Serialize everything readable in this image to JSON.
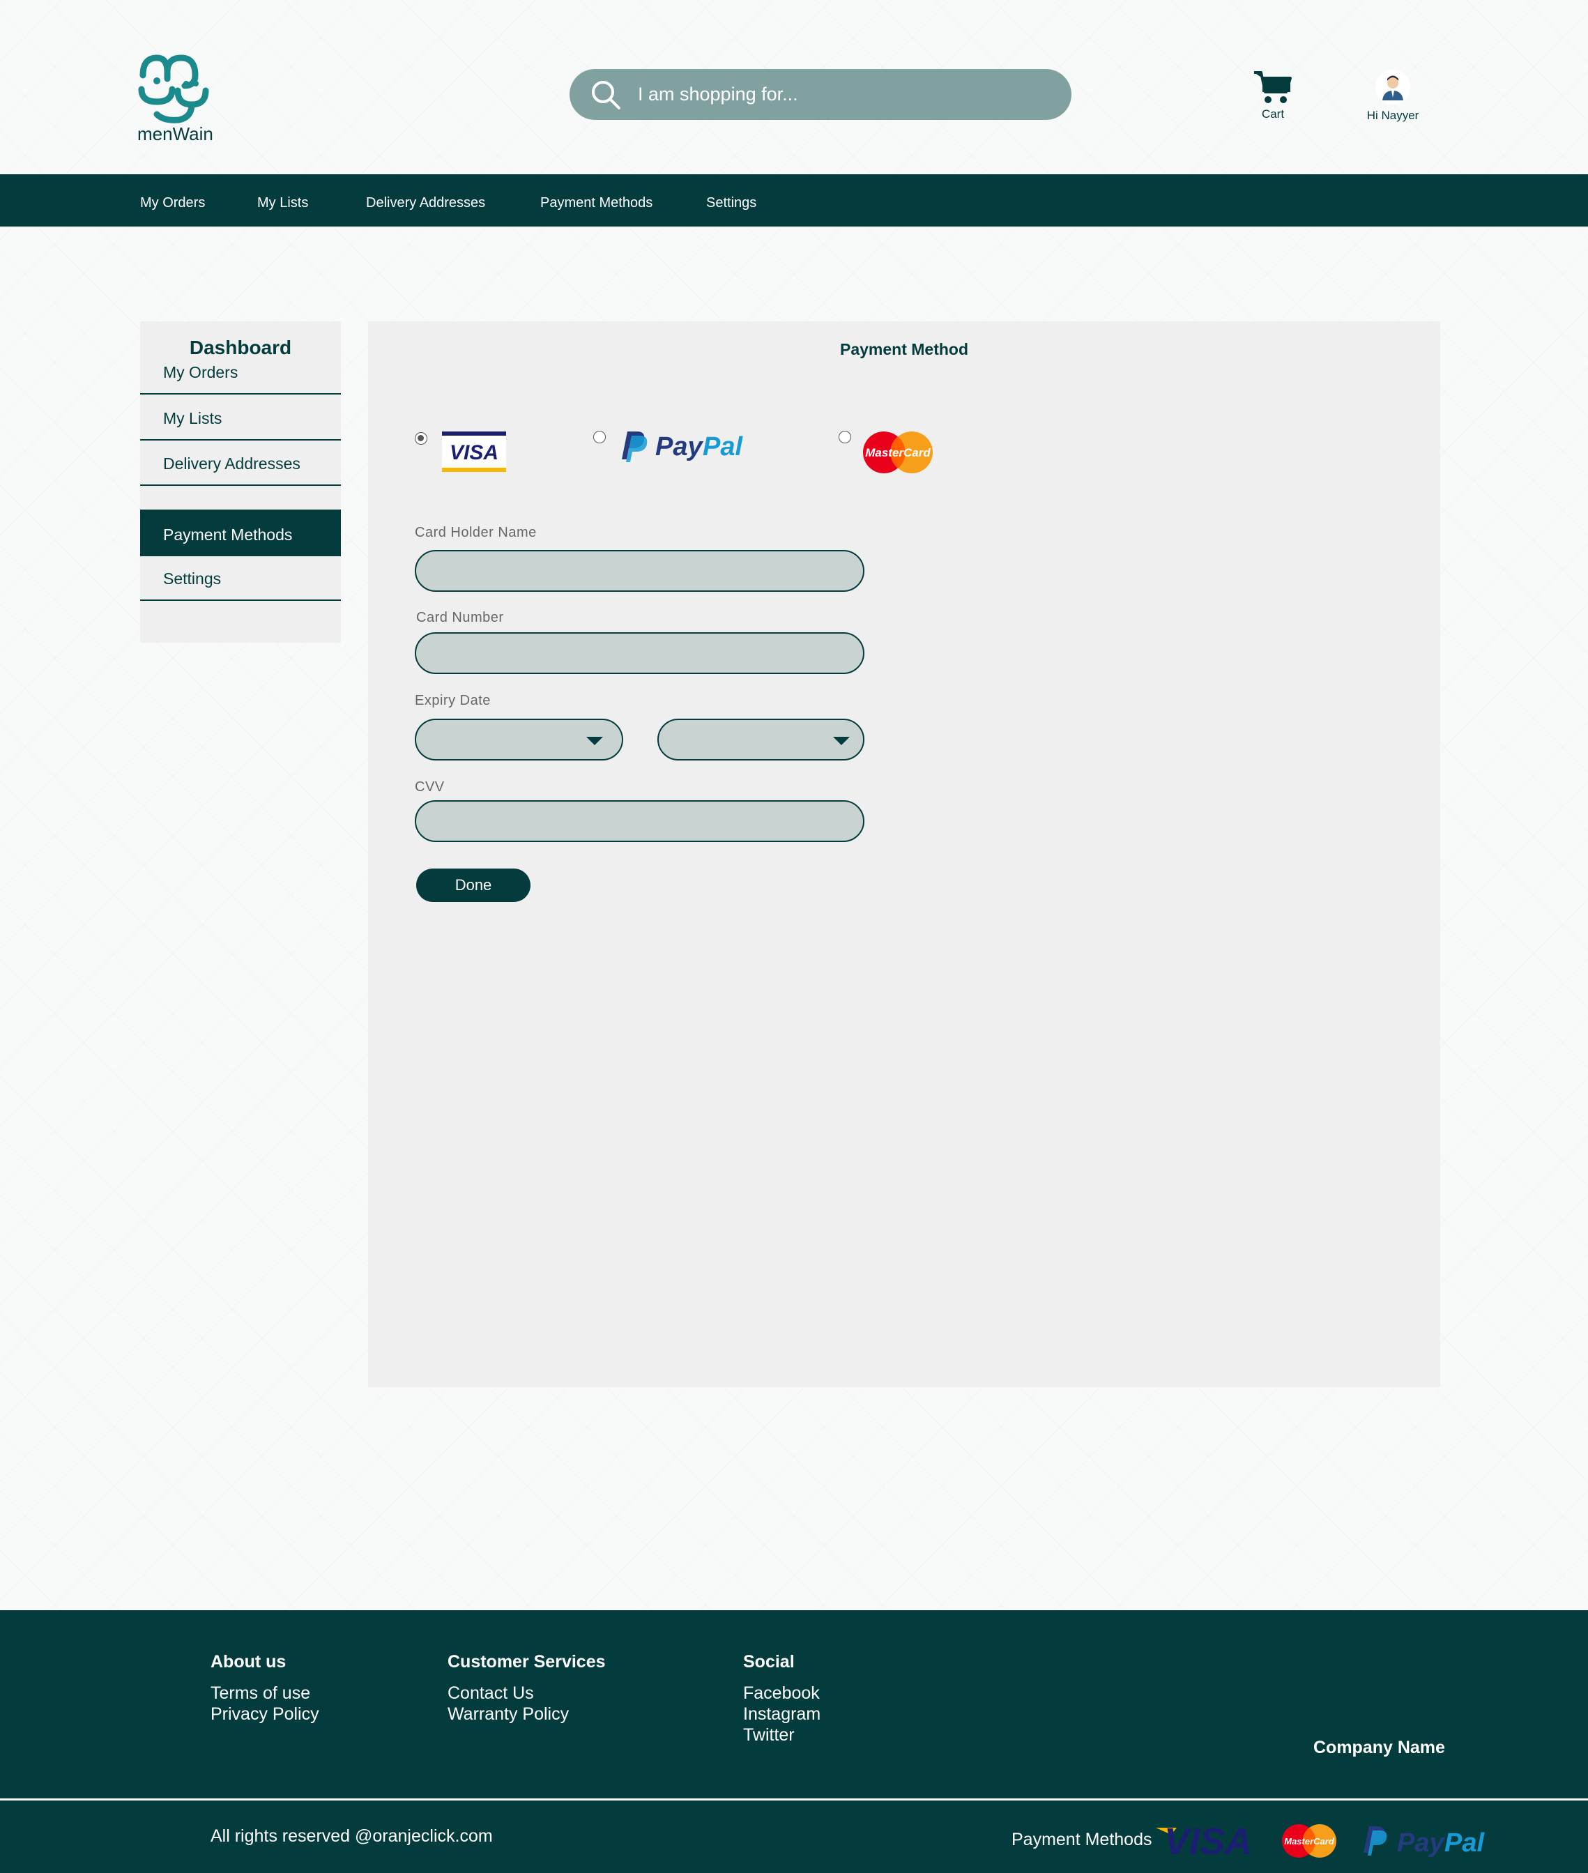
{
  "header": {
    "logo_text": "menWain",
    "search": {
      "placeholder": "I am shopping for..."
    },
    "cart_label": "Cart",
    "user_label": "Hi Nayyer"
  },
  "topnav": {
    "items": [
      {
        "label": "My Orders"
      },
      {
        "label": "My Lists"
      },
      {
        "label": "Delivery Addresses"
      },
      {
        "label": "Payment Methods"
      },
      {
        "label": "Settings"
      }
    ]
  },
  "sidebar": {
    "title": "Dashboard",
    "items": [
      {
        "label": "My Orders"
      },
      {
        "label": "My Lists"
      },
      {
        "label": "Delivery Addresses"
      },
      {
        "label": "Payment Methods",
        "active": true
      },
      {
        "label": "Settings"
      }
    ]
  },
  "payment_form": {
    "title": "Payment Method",
    "options": [
      {
        "name": "VISA",
        "selected": true
      },
      {
        "name": "PayPal",
        "selected": false
      },
      {
        "name": "MasterCard",
        "selected": false
      }
    ],
    "card_holder_label": "Card Holder Name",
    "card_number_label": "Card Number",
    "expiry_label": "Expiry Date",
    "cvv_label": "CVV",
    "done_label": "Done"
  },
  "footer": {
    "about": {
      "heading": "About us",
      "links": [
        "Terms of use",
        "Privacy Policy"
      ]
    },
    "services": {
      "heading": "Customer Services",
      "links": [
        "Contact Us",
        "Warranty Policy"
      ]
    },
    "social": {
      "heading": "Social",
      "links": [
        "Facebook",
        "Instagram",
        "Twitter"
      ]
    },
    "company": "Company Name",
    "copyright": "All rights reserved @oranjeclick.com",
    "payment_methods_label": "Payment Methods",
    "payment_logos": [
      "VISA",
      "MasterCard",
      "PayPal"
    ]
  },
  "colors": {
    "primary": "#043c3d",
    "search_bg": "#80a19f",
    "panel_bg": "#efefef",
    "input_bg": "#c9d3d2",
    "logo_teal": "#1a8a8c"
  }
}
